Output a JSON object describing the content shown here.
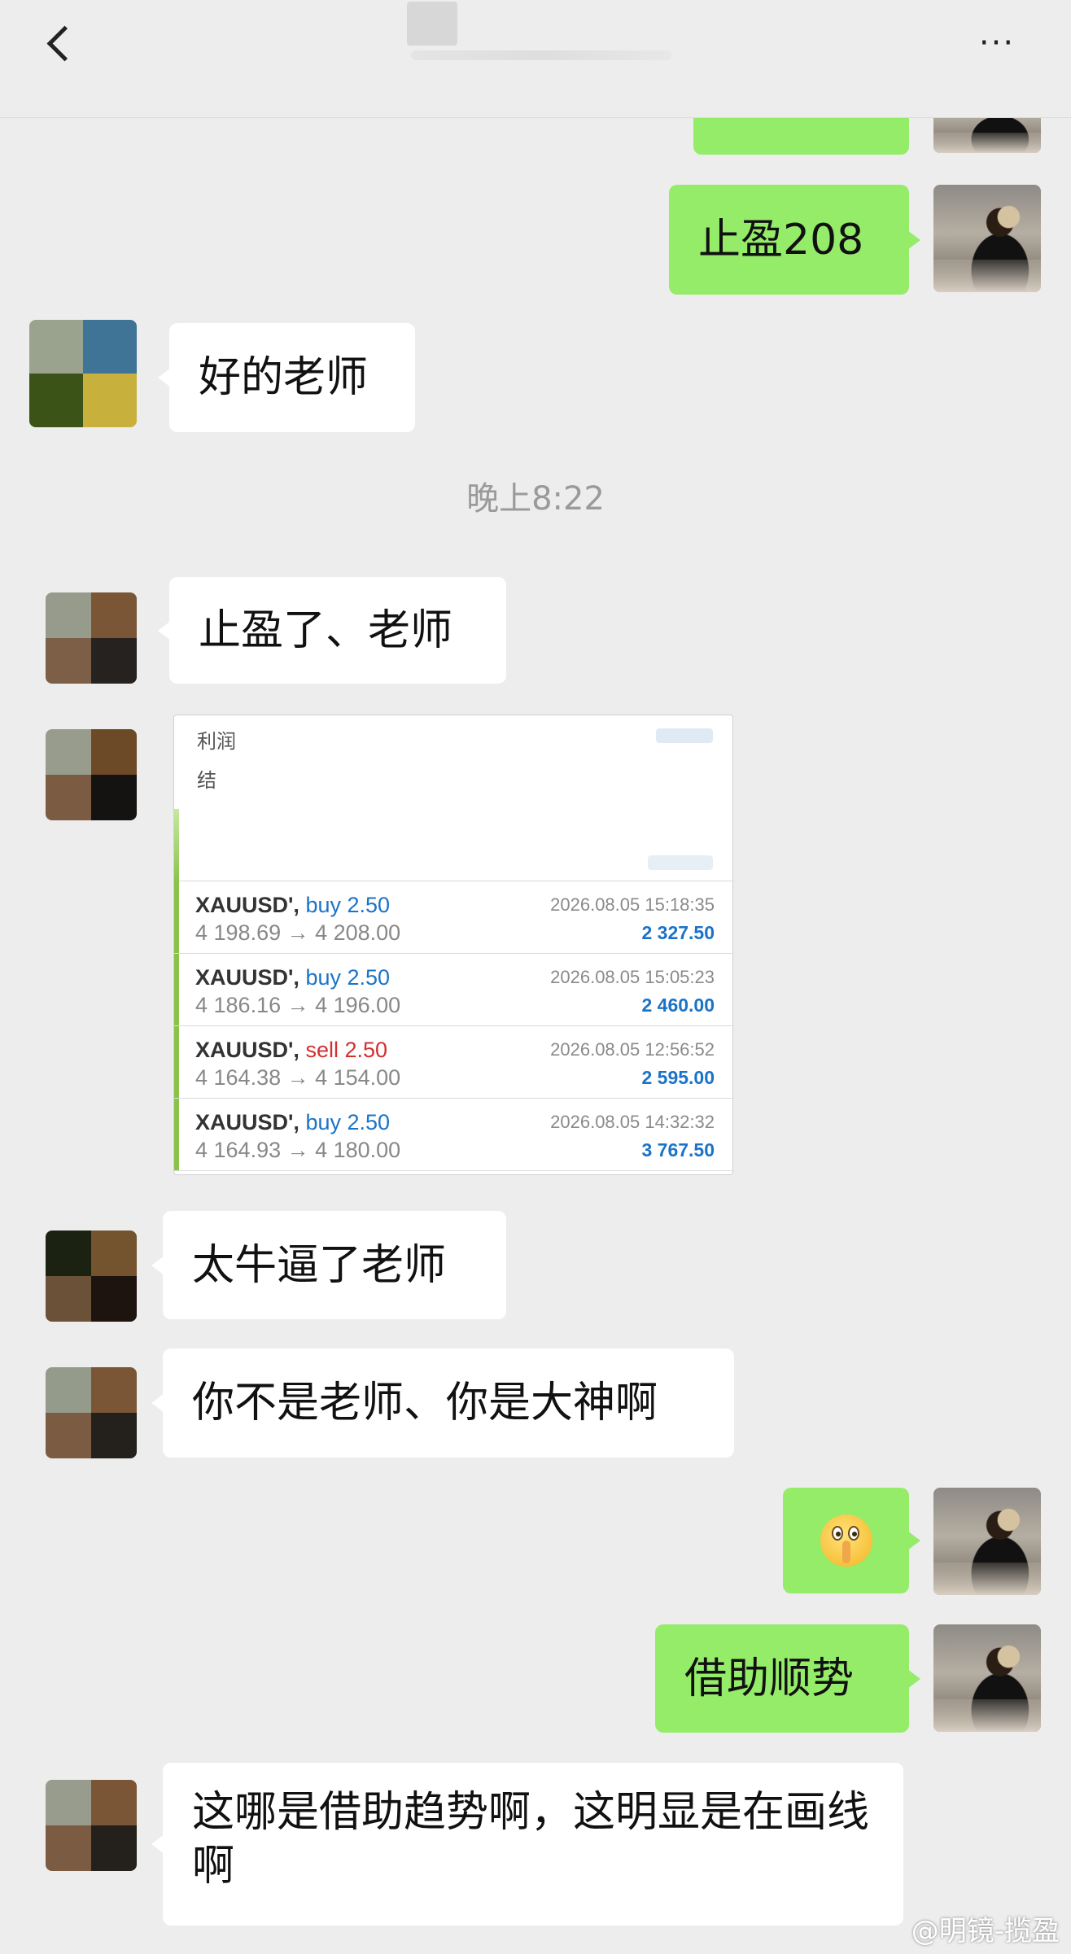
{
  "header": {
    "back_label": "",
    "more_label": "···"
  },
  "colors": {
    "my_bubble": "#95ec69",
    "other_bubble": "#ffffff",
    "background": "#ededed",
    "buy": "#1b73c8",
    "sell": "#d32f2f"
  },
  "timestamp": "晚上8:22",
  "messages": [
    {
      "from": "me",
      "text": "止盈208"
    },
    {
      "from": "other",
      "text": "好的老师"
    },
    {
      "from": "other",
      "text": "止盈了、老师"
    },
    {
      "from": "other",
      "text": "太牛逼了老师"
    },
    {
      "from": "other",
      "text": "你不是老师、你是大神啊"
    },
    {
      "from": "me",
      "emoji": "shushing-face-icon"
    },
    {
      "from": "me",
      "text": "借助顺势"
    },
    {
      "from": "other",
      "text": "这哪是借助趋势啊，这明显是在画线啊"
    }
  ],
  "trade_card": {
    "label_profit": "利润",
    "label_second": "结",
    "trades": [
      {
        "symbol": "XAUUSD',",
        "side": "buy",
        "side_label": "buy 2.50",
        "prices": "4 198.69 → 4 208.00",
        "time": "2026.08.05 15:18:35",
        "profit": "2 327.50"
      },
      {
        "symbol": "XAUUSD',",
        "side": "buy",
        "side_label": "buy 2.50",
        "prices": "4 186.16 → 4 196.00",
        "time": "2026.08.05 15:05:23",
        "profit": "2 460.00"
      },
      {
        "symbol": "XAUUSD',",
        "side": "sell",
        "side_label": "sell 2.50",
        "prices": "4 164.38 → 4 154.00",
        "time": "2026.08.05 12:56:52",
        "profit": "2 595.00"
      },
      {
        "symbol": "XAUUSD',",
        "side": "buy",
        "side_label": "buy 2.50",
        "prices": "4 164.93 → 4 180.00",
        "time": "2026.08.05 14:32:32",
        "profit": "3 767.50"
      }
    ]
  },
  "watermark": "@明镜-揽盈"
}
